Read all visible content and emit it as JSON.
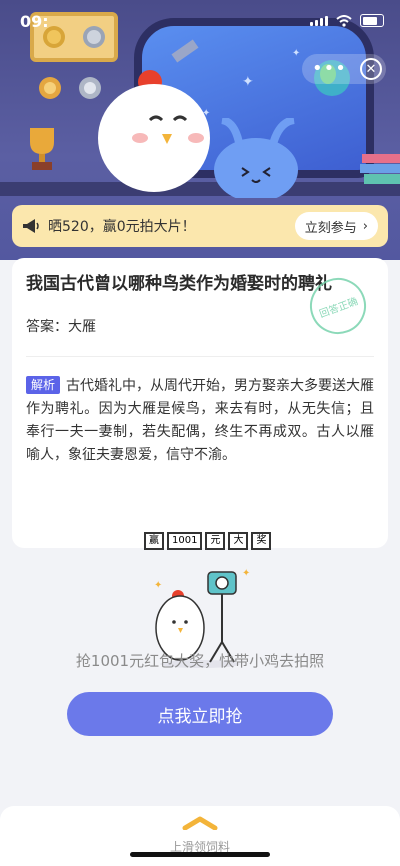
{
  "status_bar": {
    "time": "09:"
  },
  "banner": {
    "text": "晒520，赢0元拍大片！",
    "button_label": "立刻参与"
  },
  "question": {
    "title": "我国古代曾以哪种鸟类作为婚娶时的聘礼",
    "answer_label": "答案：",
    "answer_value": "大雁",
    "stamp_text": "回答正确"
  },
  "explanation": {
    "tag": "解析",
    "text": "古代婚礼中，从周代开始，男方娶亲大多要送大雁作为聘礼。因为大雁是候鸟，来去有时，从无失信；且奉行一夫一妻制，若失配偶，终生不再成双。古人以雁喻人，象征夫妻恩爱，信守不渝。"
  },
  "promo": {
    "sign_chars": [
      "赢",
      "1001",
      "元",
      "大",
      "奖"
    ],
    "text": "抢1001元红包大奖，快带小鸡去拍照",
    "cta_label": "点我立即抢"
  },
  "footer": {
    "label": "上滑领饲料"
  },
  "colors": {
    "accent": "#6b79ea",
    "tag": "#5b63e8",
    "banner_bg": "#fbe7ad",
    "hero_bg": "#4a4c8a"
  }
}
